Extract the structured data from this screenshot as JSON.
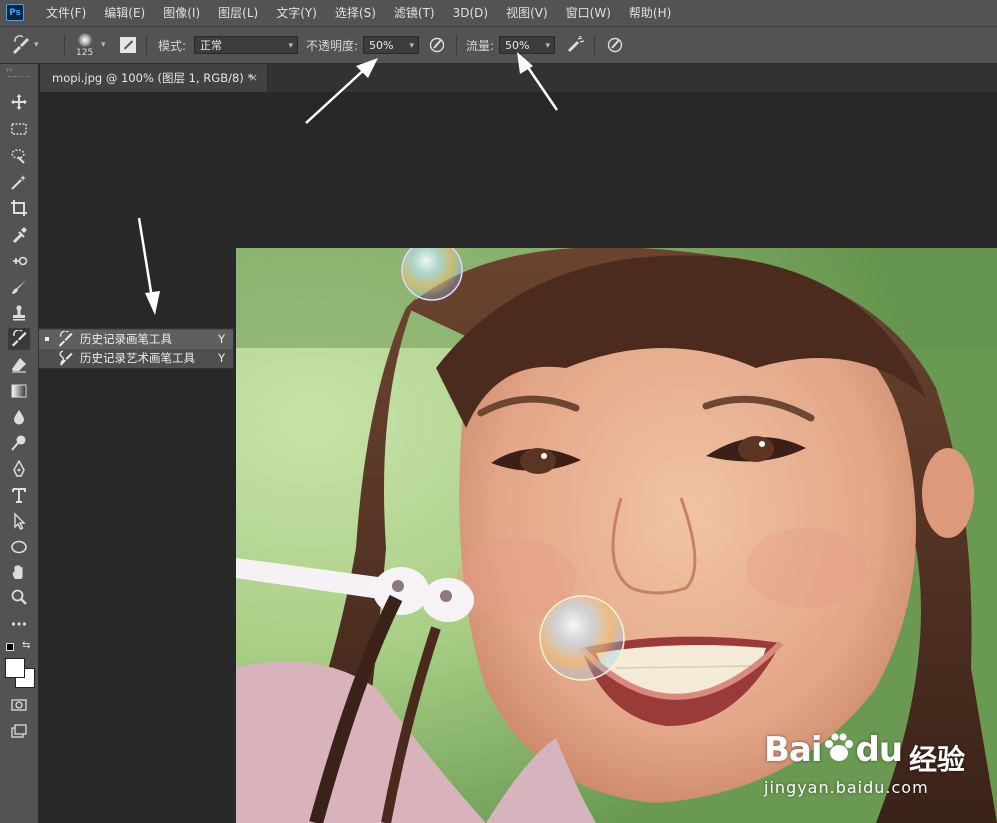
{
  "app": {
    "logo_text": "Ps"
  },
  "menu": [
    "文件(F)",
    "编辑(E)",
    "图像(I)",
    "图层(L)",
    "文字(Y)",
    "选择(S)",
    "滤镜(T)",
    "3D(D)",
    "视图(V)",
    "窗口(W)",
    "帮助(H)"
  ],
  "options": {
    "brush_size": "125",
    "mode_label": "模式:",
    "mode_value": "正常",
    "opacity_label": "不透明度:",
    "opacity_value": "50%",
    "flow_label": "流量:",
    "flow_value": "50%"
  },
  "document": {
    "tab_title": "mopi.jpg @ 100% (图层 1, RGB/8) *",
    "close_glyph": "×"
  },
  "flyout": [
    {
      "label": "历史记录画笔工具",
      "shortcut": "Y",
      "selected": true
    },
    {
      "label": "历史记录艺术画笔工具",
      "shortcut": "Y",
      "selected": false
    }
  ],
  "watermark": {
    "brand": "Bai",
    "brand2": "du",
    "cn": "经验",
    "url": "jingyan.baidu.com"
  },
  "colors": {
    "panel": "#535353",
    "canvas": "#282828",
    "accent": "#31a8ff"
  }
}
